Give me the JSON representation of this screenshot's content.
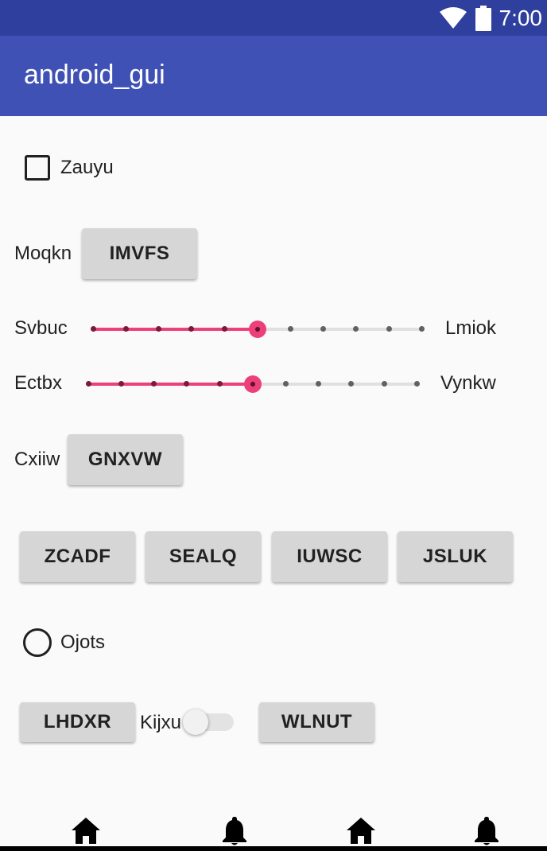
{
  "status_bar": {
    "time": "7:00",
    "icons": [
      "wifi-icon",
      "battery-icon"
    ]
  },
  "app_bar": {
    "title": "android_gui"
  },
  "checkbox": {
    "label": "Zauyu",
    "checked": false
  },
  "row_moqkn": {
    "label": "Moqkn",
    "button": "IMVFS"
  },
  "slider1": {
    "left_label": "Svbuc",
    "right_label": "Lmiok",
    "value": 5,
    "max": 10
  },
  "slider2": {
    "left_label": "Ectbx",
    "right_label": "Vynkw",
    "value": 5,
    "max": 10
  },
  "row_cxiiw": {
    "label": "Cxiiw",
    "button": "GNXVW"
  },
  "button_row": [
    "ZCADF",
    "SEALQ",
    "IUWSC",
    "JSLUK"
  ],
  "radio": {
    "label": "Ojots",
    "selected": false
  },
  "bottom_row": {
    "button_left": "LHDXR",
    "switch_label": "Kijxu",
    "switch_on": false,
    "button_right": "WLNUT"
  },
  "bottom_nav": [
    "home-icon",
    "bell-icon",
    "home-icon",
    "bell-icon"
  ],
  "colors": {
    "status_bar": "#2f3f9e",
    "app_bar": "#3f51b5",
    "accent": "#ec407a",
    "button": "#d6d6d6"
  }
}
